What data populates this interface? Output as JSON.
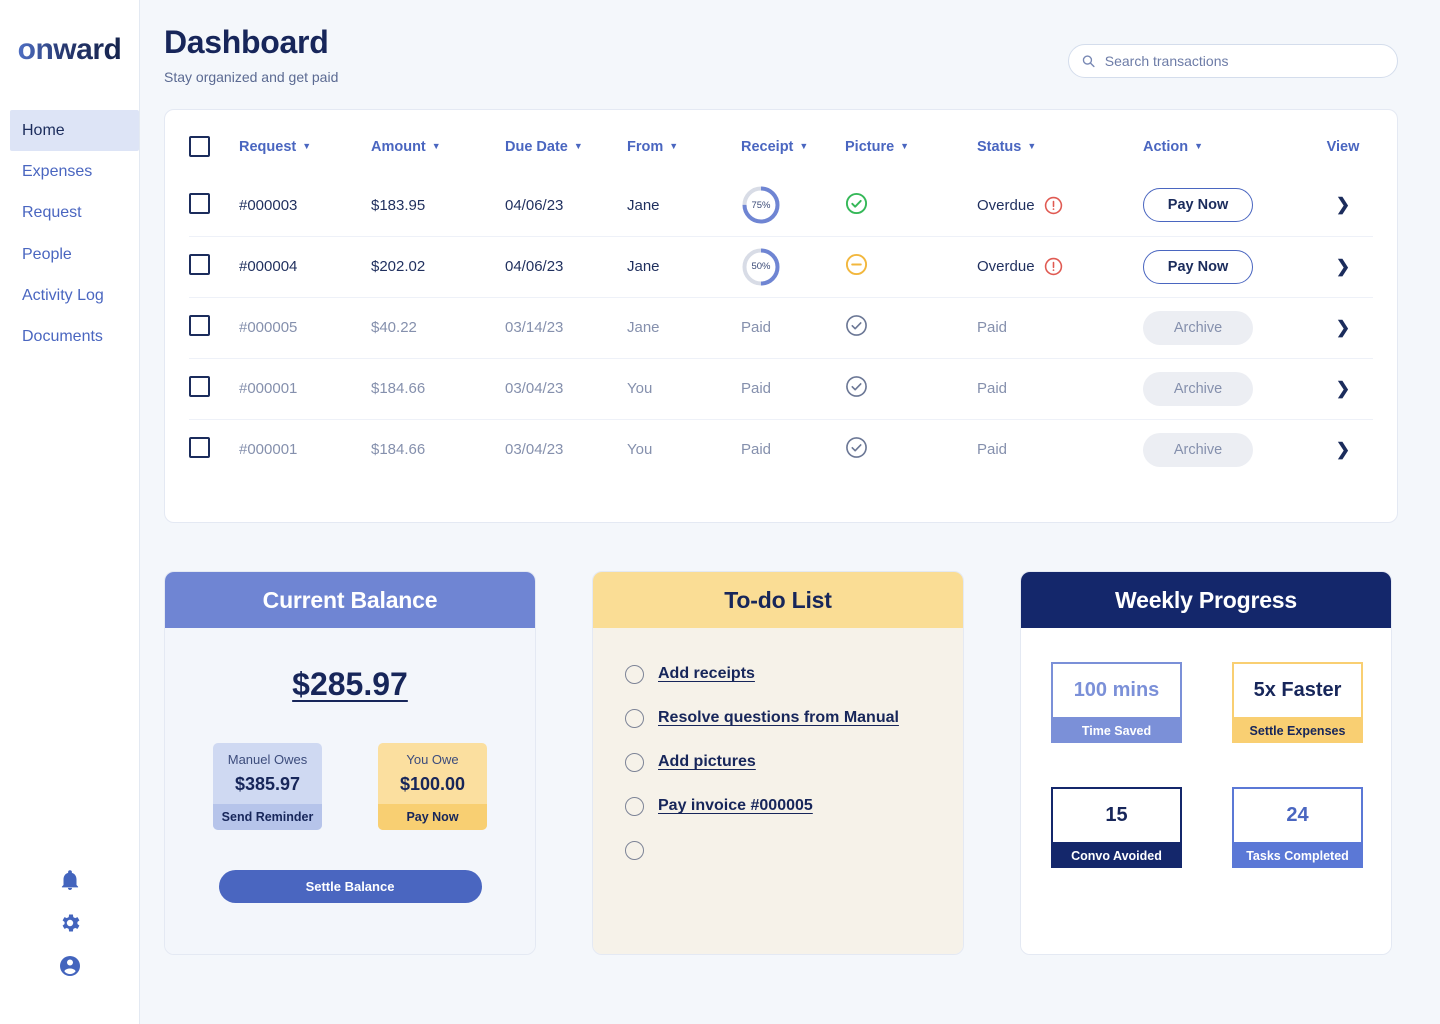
{
  "brand": {
    "logo_text": "onward"
  },
  "sidebar": {
    "items": [
      {
        "label": "Home",
        "active": true
      },
      {
        "label": "Expenses",
        "active": false
      },
      {
        "label": "Request",
        "active": false
      },
      {
        "label": "People",
        "active": false
      },
      {
        "label": "Activity Log",
        "active": false
      },
      {
        "label": "Documents",
        "active": false
      }
    ],
    "bottom_icons": [
      "bell-icon",
      "gear-icon",
      "account-circle-icon"
    ]
  },
  "header": {
    "title": "Dashboard",
    "subtitle": "Stay organized and get paid",
    "search": {
      "placeholder": "Search transactions",
      "value": "",
      "icon": "search-icon"
    }
  },
  "table": {
    "columns": [
      {
        "label": "Request",
        "sortable": true
      },
      {
        "label": "Amount",
        "sortable": true
      },
      {
        "label": "Due Date",
        "sortable": true
      },
      {
        "label": "From",
        "sortable": true
      },
      {
        "label": "Receipt",
        "sortable": true
      },
      {
        "label": "Picture",
        "sortable": true
      },
      {
        "label": "Status",
        "sortable": true
      },
      {
        "label": "Action",
        "sortable": true
      },
      {
        "label": "View",
        "sortable": false
      }
    ],
    "rows": [
      {
        "request": "#000003",
        "amount": "$183.95",
        "due_date": "04/06/23",
        "from": "Jane",
        "receipt_type": "progress",
        "receipt_percent": 75,
        "receipt_text": "75%",
        "picture_icon": "check-circle-icon",
        "picture_state": "complete",
        "status": "Overdue",
        "status_icon": "alert-circle-icon",
        "status_state": "overdue",
        "action": "Pay Now",
        "action_style": "outline",
        "view_icon": "chevron-right-icon"
      },
      {
        "request": "#000004",
        "amount": "$202.02",
        "due_date": "04/06/23",
        "from": "Jane",
        "receipt_type": "progress",
        "receipt_percent": 50,
        "receipt_text": "50%",
        "picture_icon": "minus-circle-icon",
        "picture_state": "partial",
        "status": "Overdue",
        "status_icon": "alert-circle-icon",
        "status_state": "overdue",
        "action": "Pay Now",
        "action_style": "outline",
        "view_icon": "chevron-right-icon"
      },
      {
        "request": "#000005",
        "amount": "$40.22",
        "due_date": "03/14/23",
        "from": "Jane",
        "receipt_type": "text",
        "receipt_text": "Paid",
        "picture_icon": "check-circle-icon",
        "picture_state": "muted",
        "status": "Paid",
        "status_icon": "",
        "status_state": "paid",
        "action": "Archive",
        "action_style": "muted",
        "view_icon": "chevron-right-icon"
      },
      {
        "request": "#000001",
        "amount": "$184.66",
        "due_date": "03/04/23",
        "from": "You",
        "receipt_type": "text",
        "receipt_text": "Paid",
        "picture_icon": "check-circle-icon",
        "picture_state": "muted",
        "status": "Paid",
        "status_icon": "",
        "status_state": "paid",
        "action": "Archive",
        "action_style": "muted",
        "view_icon": "chevron-right-icon"
      },
      {
        "request": "#000001",
        "amount": "$184.66",
        "due_date": "03/04/23",
        "from": "You",
        "receipt_type": "text",
        "receipt_text": "Paid",
        "picture_icon": "check-circle-icon",
        "picture_state": "muted",
        "status": "Paid",
        "status_icon": "",
        "status_state": "paid",
        "action": "Archive",
        "action_style": "muted",
        "view_icon": "chevron-right-icon"
      }
    ]
  },
  "current_balance": {
    "title": "Current Balance",
    "amount": "$285.97",
    "owed_to_you": {
      "label": "Manuel Owes",
      "amount": "$385.97",
      "action": "Send Reminder"
    },
    "you_owe": {
      "label": "You Owe",
      "amount": "$100.00",
      "action": "Pay Now"
    },
    "settle_label": "Settle Balance"
  },
  "todo": {
    "title": "To-do List",
    "items": [
      {
        "label": "Add receipts",
        "done": false
      },
      {
        "label": "Resolve questions from Manual",
        "done": false
      },
      {
        "label": "Add pictures",
        "done": false
      },
      {
        "label": "Pay invoice #000005",
        "done": false
      },
      {
        "label": "",
        "done": false
      }
    ]
  },
  "weekly_progress": {
    "title": "Weekly Progress",
    "stats": [
      {
        "value": "100 mins",
        "label": "Time Saved",
        "border": "#7b90d8",
        "fill": "#7b90d8",
        "value_color": "#7b90d8",
        "label_color": "#ffffff"
      },
      {
        "value": "5x Faster",
        "label": "Settle Expenses",
        "border": "#f9cf72",
        "fill": "#f9cf72",
        "value_color": "#17265a",
        "label_color": "#17265a"
      },
      {
        "value": "15",
        "label": "Convo Avoided",
        "border": "#14276b",
        "fill": "#14276b",
        "value_color": "#17265a",
        "label_color": "#ffffff"
      },
      {
        "value": "24",
        "label": "Tasks Completed",
        "border": "#5b78d6",
        "fill": "#5b78d6",
        "value_color": "#4a66c0",
        "label_color": "#ffffff"
      }
    ]
  },
  "colors": {
    "accent_blue": "#4a66c0",
    "navy": "#17265a",
    "gold": "#fadd95",
    "periwinkle": "#6f85d3",
    "success_green": "#35b858",
    "warning_amber": "#f2b73d",
    "danger_red": "#e05a52",
    "page_bg": "#f4f7fb"
  }
}
